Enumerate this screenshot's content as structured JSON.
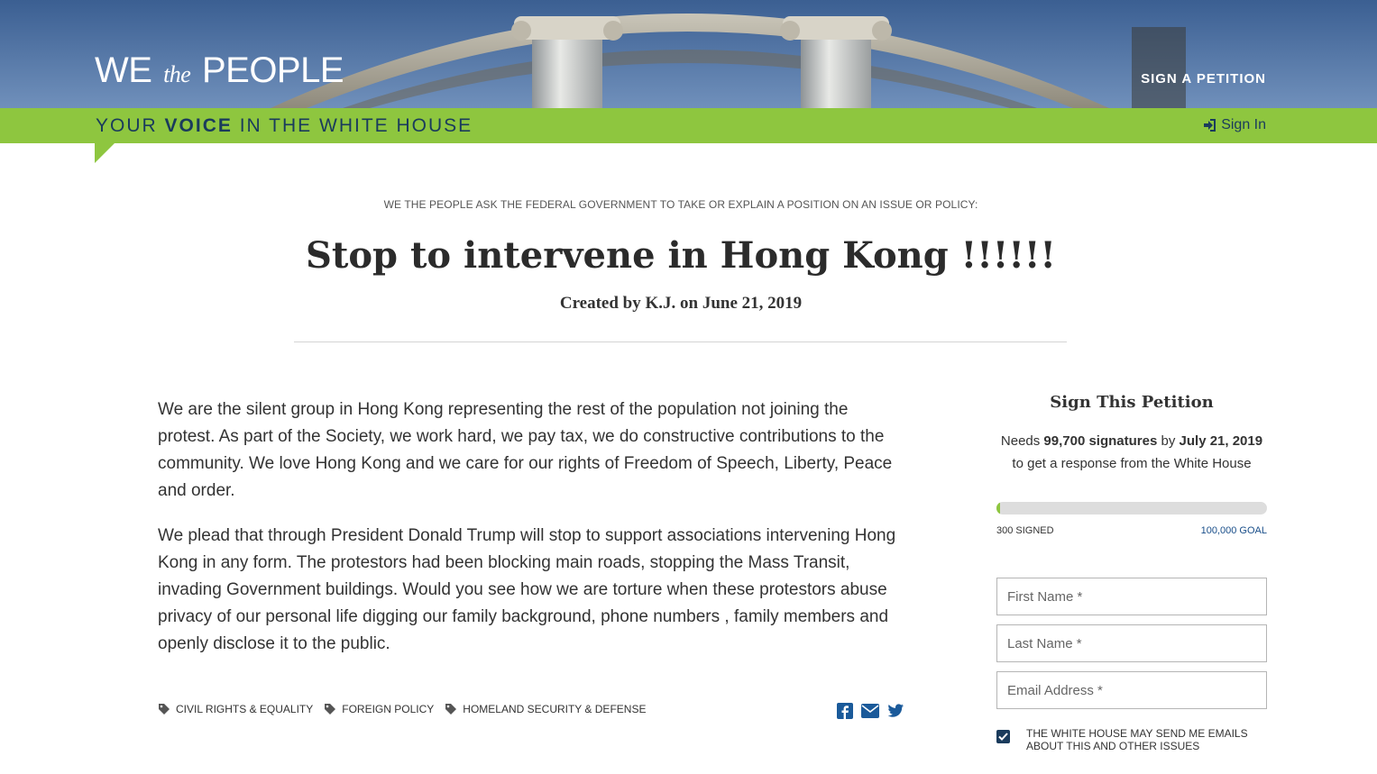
{
  "header": {
    "brand_we": "WE",
    "brand_the": "the",
    "brand_people": "PEOPLE",
    "nav_sign_petition": "SIGN A PETITION",
    "tagline_pre": "YOUR ",
    "tagline_bold": "VOICE",
    "tagline_post": " IN THE WHITE HOUSE",
    "sign_in": "Sign In"
  },
  "petition": {
    "ask_line": "WE THE PEOPLE ASK THE FEDERAL GOVERNMENT TO TAKE OR EXPLAIN A POSITION ON AN ISSUE OR POLICY:",
    "title": "Stop to intervene in Hong Kong !!!!!!",
    "byline": "Created by K.J. on June 21, 2019",
    "paragraphs": [
      "We are the silent group in Hong Kong representing the rest of the population not joining the protest. As part of the Society, we work hard, we pay tax, we do constructive contributions to the community. We love Hong Kong and we care for our rights of Freedom of Speech, Liberty, Peace and order.",
      "We plead that through President Donald Trump will stop to support associations intervening Hong Kong in any form. The protestors had been blocking main roads, stopping the Mass Transit, invading Government buildings. Would you see how we are torture when these protestors abuse privacy of our personal life digging our family background, phone numbers , family members and openly disclose it to the public."
    ],
    "tags": [
      "CIVIL RIGHTS & EQUALITY",
      "FOREIGN POLICY",
      "HOMELAND SECURITY & DEFENSE"
    ],
    "share_icons": [
      "facebook-icon",
      "email-icon",
      "twitter-icon"
    ]
  },
  "sidebar": {
    "title": "Sign This Petition",
    "needs_pre": "Needs ",
    "needs_count": "99,700 signatures",
    "needs_mid": " by ",
    "needs_date": "July 21, 2019",
    "needs_post": " to get a response from the White House",
    "progress_fraction": 0.003,
    "signed_label": "300 SIGNED",
    "goal_label": "100,000 GOAL",
    "first_name_placeholder": "First Name *",
    "last_name_placeholder": "Last Name *",
    "email_placeholder": "Email Address *",
    "consent_text": "THE WHITE HOUSE MAY SEND ME EMAILS ABOUT THIS AND OTHER ISSUES",
    "consent_checked": true
  },
  "colors": {
    "green": "#8ec63f",
    "navy": "#1a3b5c",
    "sky": "#4f74a5",
    "link_blue": "#1a4f8a"
  }
}
